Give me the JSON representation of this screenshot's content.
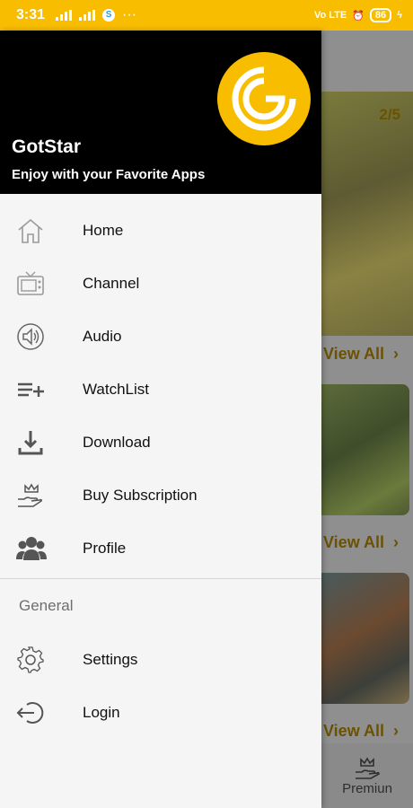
{
  "status_bar": {
    "time": "3:31",
    "network": "Vo LTE",
    "battery": "86"
  },
  "drawer": {
    "app_name": "GotStar",
    "tagline": "Enjoy with your Favorite Apps",
    "logo_icon": "gotstar-logo-icon",
    "menu": [
      {
        "label": "Home",
        "icon": "home-icon"
      },
      {
        "label": "Channel",
        "icon": "tv-icon"
      },
      {
        "label": "Audio",
        "icon": "speaker-icon"
      },
      {
        "label": "WatchList",
        "icon": "playlist-add-icon"
      },
      {
        "label": "Download",
        "icon": "download-icon"
      },
      {
        "label": "Buy Subscription",
        "icon": "crown-hand-icon"
      },
      {
        "label": "Profile",
        "icon": "group-icon"
      }
    ],
    "general_title": "General",
    "general_menu": [
      {
        "label": "Settings",
        "icon": "gear-icon"
      },
      {
        "label": "Login",
        "icon": "login-icon"
      }
    ]
  },
  "background": {
    "banner_counter": "2/5",
    "view_all_label": "View All",
    "premium_label": "Premiun"
  },
  "colors": {
    "accent": "#f9bd00",
    "header_bg": "#000000",
    "drawer_bg": "#f5f5f5",
    "icon": "#555555"
  }
}
